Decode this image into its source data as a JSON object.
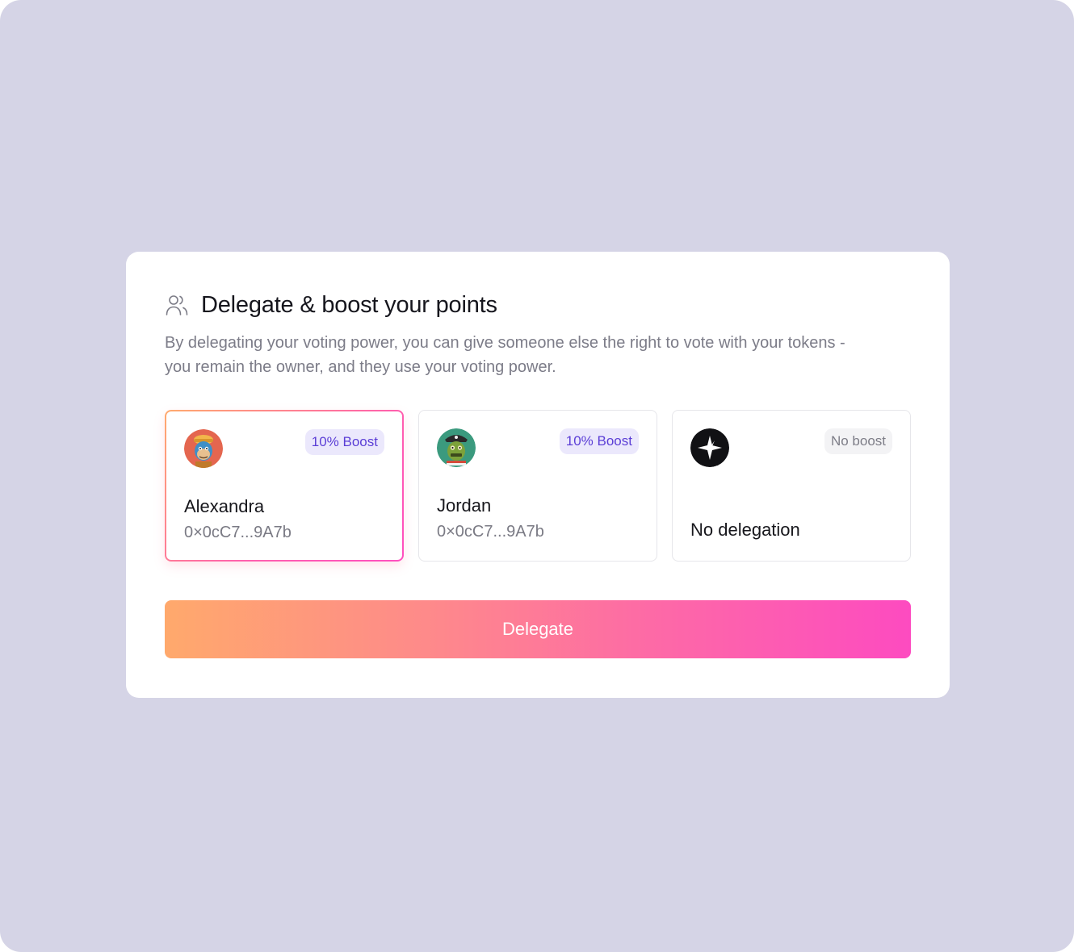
{
  "dialog": {
    "title": "Delegate & boost your points",
    "description": "By delegating your voting power, you can give someone else the right to vote with your tokens - you remain the owner, and they use your voting power.",
    "header_icon": "users-icon"
  },
  "options": [
    {
      "name": "Alexandra",
      "address": "0×0cC7...9A7b",
      "badge": "10% Boost",
      "avatar": "ape-avatar",
      "selected": true
    },
    {
      "name": "Jordan",
      "address": "0×0cC7...9A7b",
      "badge": "10% Boost",
      "avatar": "pirate-zombie-avatar",
      "selected": false
    },
    {
      "name": "No delegation",
      "badge": "No boost",
      "avatar": "sparkle-icon",
      "selected": false
    }
  ],
  "actions": {
    "delegate_label": "Delegate"
  },
  "colors": {
    "backdrop": "#d5d4e6",
    "boost_badge_bg": "#ebe8fc",
    "boost_badge_text": "#5b3ed6",
    "gradient_start": "#ffa96c",
    "gradient_end": "#fd4bc0"
  }
}
